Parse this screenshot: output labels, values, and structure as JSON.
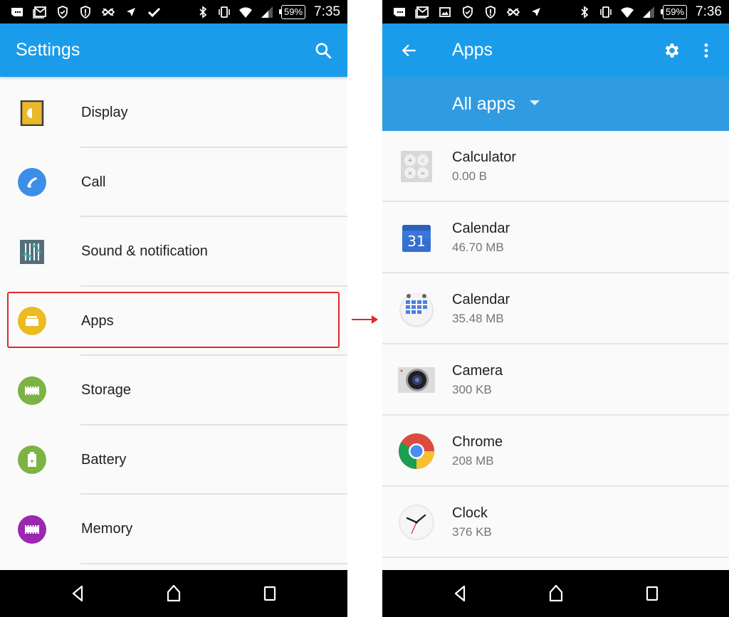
{
  "left_screen": {
    "status_bar": {
      "left_icons": [
        "chat-bubble-icon",
        "gmail-icon",
        "shield-check-icon",
        "shield-alert-icon",
        "network-icon",
        "location-arrow-icon",
        "checkmark-icon"
      ],
      "right_icons": [
        "bluetooth-icon",
        "vibrate-icon",
        "wifi-icon",
        "signal-icon"
      ],
      "battery": "59%",
      "time": "7:35"
    },
    "app_bar": {
      "title": "Settings",
      "search_icon": "search-icon"
    },
    "settings_items": [
      {
        "label": "Display",
        "icon": "display-icon",
        "color": "#e8b82a"
      },
      {
        "label": "Call",
        "icon": "call-icon",
        "color": "#3d8ee8"
      },
      {
        "label": "Sound & notification",
        "icon": "sound-icon",
        "color": "#546e7a"
      },
      {
        "label": "Apps",
        "icon": "apps-icon",
        "color": "#ecbb20"
      },
      {
        "label": "Storage",
        "icon": "storage-icon",
        "color": "#7cb342"
      },
      {
        "label": "Battery",
        "icon": "battery-icon",
        "color": "#7cb342"
      },
      {
        "label": "Memory",
        "icon": "memory-icon",
        "color": "#9c27b0"
      }
    ],
    "highlighted_item": "Apps"
  },
  "right_screen": {
    "status_bar": {
      "left_icons": [
        "chat-bubble-icon",
        "gmail-icon",
        "image-icon",
        "shield-check-icon",
        "shield-alert-icon",
        "network-icon",
        "location-arrow-icon"
      ],
      "right_icons": [
        "bluetooth-icon",
        "vibrate-icon",
        "wifi-icon",
        "signal-icon"
      ],
      "battery": "59%",
      "time": "7:36"
    },
    "app_bar": {
      "title": "Apps",
      "back_icon": "back-arrow-icon",
      "settings_icon": "gear-icon",
      "more_icon": "more-vert-icon"
    },
    "filter": {
      "selected": "All apps"
    },
    "apps": [
      {
        "name": "Calculator",
        "size": "0.00 B",
        "icon": "calculator-icon"
      },
      {
        "name": "Calendar",
        "size": "46.70 MB",
        "icon": "google-calendar-icon"
      },
      {
        "name": "Calendar",
        "size": "35.48 MB",
        "icon": "calendar-icon"
      },
      {
        "name": "Camera",
        "size": "300 KB",
        "icon": "camera-icon"
      },
      {
        "name": "Chrome",
        "size": "208 MB",
        "icon": "chrome-icon"
      },
      {
        "name": "Clock",
        "size": "376 KB",
        "icon": "clock-icon"
      }
    ]
  },
  "colors": {
    "app_bar": "#1a9cea",
    "sub_bar": "#2f9be0",
    "highlight": "#e0282a"
  }
}
